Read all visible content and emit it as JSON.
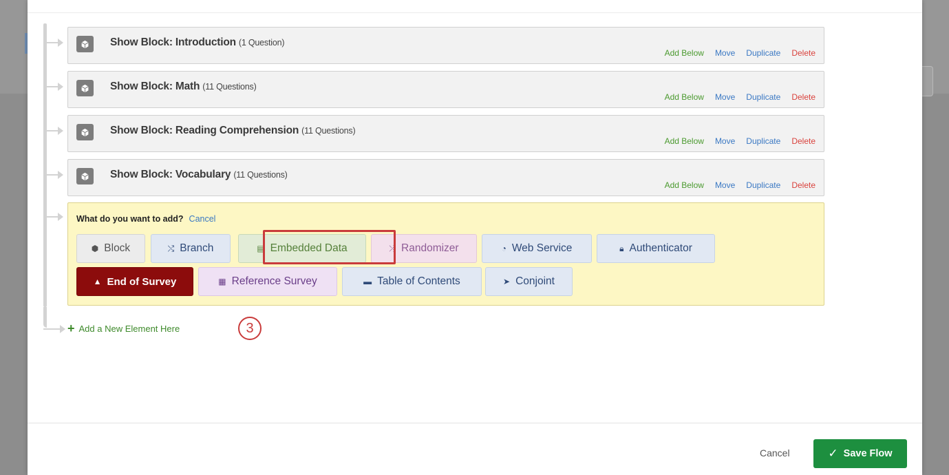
{
  "flow": {
    "blocks": [
      {
        "title": "Show Block: Introduction",
        "count": "(1 Question)"
      },
      {
        "title": "Show Block: Math",
        "count": "(11 Questions)"
      },
      {
        "title": "Show Block: Reading Comprehension",
        "count": "(11 Questions)"
      },
      {
        "title": "Show Block: Vocabulary",
        "count": "(11 Questions)"
      }
    ],
    "actions": {
      "add_below": "Add Below",
      "move": "Move",
      "duplicate": "Duplicate",
      "delete": "Delete"
    }
  },
  "add_panel": {
    "prompt": "What do you want to add?",
    "cancel": "Cancel",
    "elements": {
      "block": "Block",
      "branch": "Branch",
      "embedded_data": "Embedded Data",
      "randomizer": "Randomizer",
      "web_service": "Web Service",
      "authenticator": "Authenticator",
      "end_of_survey": "End of Survey",
      "reference_survey": "Reference Survey",
      "table_of_contents": "Table of Contents",
      "conjoint": "Conjoint"
    }
  },
  "add_new_element": "Add a New Element Here",
  "step_badge": "3",
  "footer": {
    "cancel": "Cancel",
    "save": "Save Flow"
  },
  "colors": {
    "add_below": "#4b9a2f",
    "link_blue": "#3a78c3",
    "delete_red": "#d9413c",
    "end_of_survey_bg": "#8c0c0c",
    "save_green": "#1d8f3f",
    "highlight": "#c93b3b",
    "panel_yellow": "#fdf7c4"
  },
  "icons": {
    "block": "cube-icon",
    "branch": "branch-icon",
    "embedded_data": "data-card-icon",
    "randomizer": "shuffle-icon",
    "web_service": "rss-icon",
    "authenticator": "lock-icon",
    "end_of_survey": "warning-icon",
    "reference_survey": "clipboard-icon",
    "table_of_contents": "list-icon",
    "conjoint": "conjoint-icon",
    "add_new": "plus-icon",
    "save": "check-icon"
  }
}
